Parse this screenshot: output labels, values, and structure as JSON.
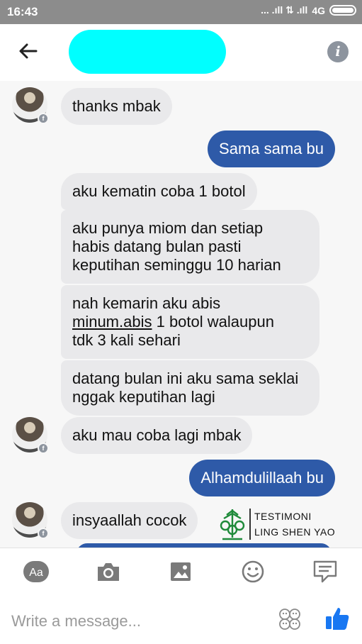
{
  "status_bar": {
    "time": "16:43",
    "signal_text": "... .ıll ⇅ .ıll",
    "network": "4G"
  },
  "header": {
    "back_icon": "arrow-left",
    "info_icon": "info",
    "info_glyph": "i"
  },
  "messages": [
    {
      "dir": "in",
      "text": "thanks mbak"
    },
    {
      "dir": "out",
      "text": "Sama sama bu"
    },
    {
      "dir": "in",
      "text": "aku kematin coba 1 botol"
    },
    {
      "dir": "in",
      "lines": [
        "aku punya miom dan setiap",
        "habis datang bulan pasti",
        "keputihan seminggu 10 harian"
      ]
    },
    {
      "dir": "in",
      "line1": "nah kemarin aku abis",
      "line2_link": "minum.abis",
      "line2_rest": " 1 botol walaupun",
      "line3": "tdk 3 kali sehari"
    },
    {
      "dir": "in",
      "lines": [
        "datang bulan ini aku sama seklai",
        "nggak keputihan lagi"
      ]
    },
    {
      "dir": "in",
      "text": "aku mau coba lagi mbak"
    },
    {
      "dir": "out",
      "text": "Alhamdulillaah bu"
    },
    {
      "dir": "in",
      "text": "insyaallah cocok"
    }
  ],
  "watermark": {
    "line1": "TESTIMONI",
    "line2": "LING SHEN YAO"
  },
  "toolbar": {
    "aa_label": "Aa"
  },
  "composer": {
    "placeholder": "Write a message..."
  },
  "colors": {
    "outgoing": "#2e5aa8",
    "incoming": "#e9e9eb",
    "status_bar": "#8c8c8c",
    "like": "#1877f2",
    "redacted_name": "#00ffff"
  }
}
